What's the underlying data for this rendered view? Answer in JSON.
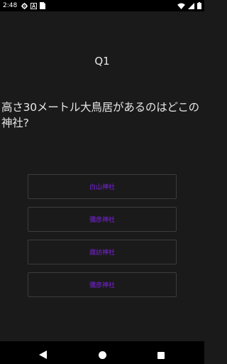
{
  "status_bar": {
    "time": "2:48",
    "left_icons": [
      "gear-icon",
      "a-notification-icon",
      "sim-card-icon"
    ],
    "right_icons": [
      "wifi-icon",
      "signal-icon",
      "battery-icon"
    ]
  },
  "quiz": {
    "question_number": "Q1",
    "question_text": "高さ30メートル大鳥居があるのはどこの神社?",
    "answers": [
      {
        "label": "白山神社"
      },
      {
        "label": "彌彦神社"
      },
      {
        "label": "諏訪神社"
      },
      {
        "label": "彌彦神社"
      }
    ]
  },
  "nav_bar": {
    "icons": [
      "back-icon",
      "home-icon",
      "recents-icon"
    ]
  },
  "colors": {
    "background": "#1a1a1a",
    "bar": "#000000",
    "text": "#e6e6e6",
    "accent": "#7b22e0",
    "button_border": "#3c3c3c"
  }
}
